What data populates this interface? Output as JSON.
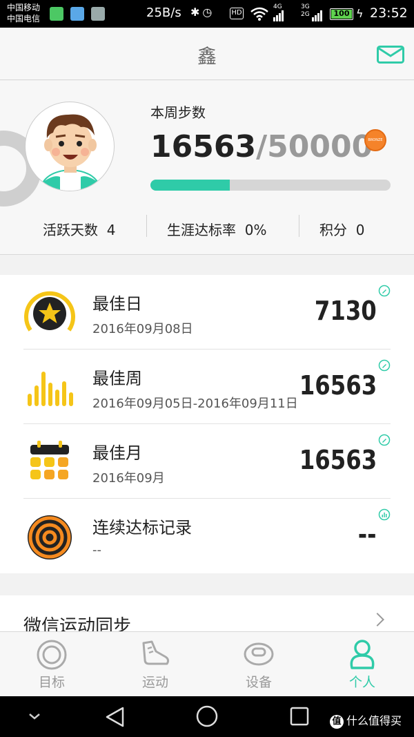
{
  "status_bar": {
    "carrier_1": "中国移动",
    "carrier_2": "中国电信",
    "net_speed": "25B/s",
    "hd": "HD",
    "net_type_1": "4G",
    "net_type_2a": "3G",
    "net_type_2b": "2G",
    "battery": "100",
    "time": "23:52"
  },
  "header": {
    "title": "鑫",
    "mail_icon": "mail-icon"
  },
  "profile": {
    "avatar": "cartoon-boy-avatar",
    "steps_label": "本周步数",
    "steps_current": "16563",
    "steps_separator": "/",
    "steps_goal": "50000",
    "steps_progress": 0.33,
    "badge_text": "BRONZE",
    "stats": [
      {
        "label": "活跃天数",
        "value": "4"
      },
      {
        "label": "生涯达标率",
        "value": "0%"
      },
      {
        "label": "积分",
        "value": "0"
      }
    ]
  },
  "records": [
    {
      "title": "最佳日",
      "date": "2016年09月08日",
      "value": "7130",
      "icon": "star-medal-icon",
      "action_icon": "edit-icon"
    },
    {
      "title": "最佳周",
      "date": "2016年09月05日-2016年09月11日",
      "value": "16563",
      "icon": "bar-chart-icon",
      "action_icon": "edit-icon"
    },
    {
      "title": "最佳月",
      "date": "2016年09月",
      "value": "16563",
      "icon": "calendar-icon",
      "action_icon": "edit-icon"
    },
    {
      "title": "连续达标记录",
      "date": "--",
      "value": "--",
      "icon": "target-icon",
      "action_icon": "stats-icon"
    }
  ],
  "wechat": {
    "label": "微信运动同步"
  },
  "tabs": [
    {
      "label": "目标",
      "icon": "target-tab-icon",
      "active": false
    },
    {
      "label": "运动",
      "icon": "shoe-icon",
      "active": false
    },
    {
      "label": "设备",
      "icon": "band-icon",
      "active": false
    },
    {
      "label": "个人",
      "icon": "person-icon",
      "active": true
    }
  ],
  "watermark": {
    "logo": "值",
    "text": "什么值得买"
  },
  "colors": {
    "accent": "#2fcba8",
    "gold": "#f5c518",
    "orange": "#f5832a"
  }
}
